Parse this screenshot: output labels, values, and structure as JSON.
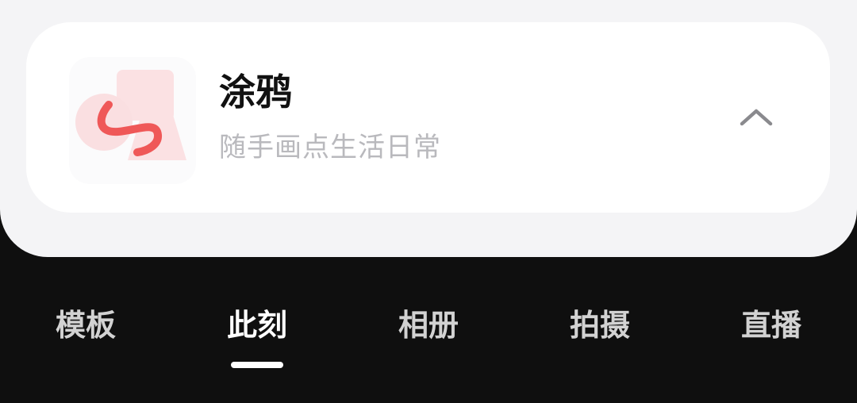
{
  "panel": {
    "item": {
      "icon": "doodle-brush-icon",
      "title": "涂鸦",
      "subtitle": "随手画点生活日常",
      "collapse_icon": "chevron-up-icon"
    }
  },
  "mode_tabs": {
    "items": [
      {
        "label": "模板",
        "active": false
      },
      {
        "label": "此刻",
        "active": true
      },
      {
        "label": "相册",
        "active": false
      },
      {
        "label": "拍摄",
        "active": false
      },
      {
        "label": "直播",
        "active": false
      }
    ]
  },
  "colors": {
    "accent_stroke": "#ef5454",
    "shape_fill": "#fbe0e2",
    "sheet_bg": "#f4f4f6",
    "dark_bg": "#0f0f0f"
  }
}
